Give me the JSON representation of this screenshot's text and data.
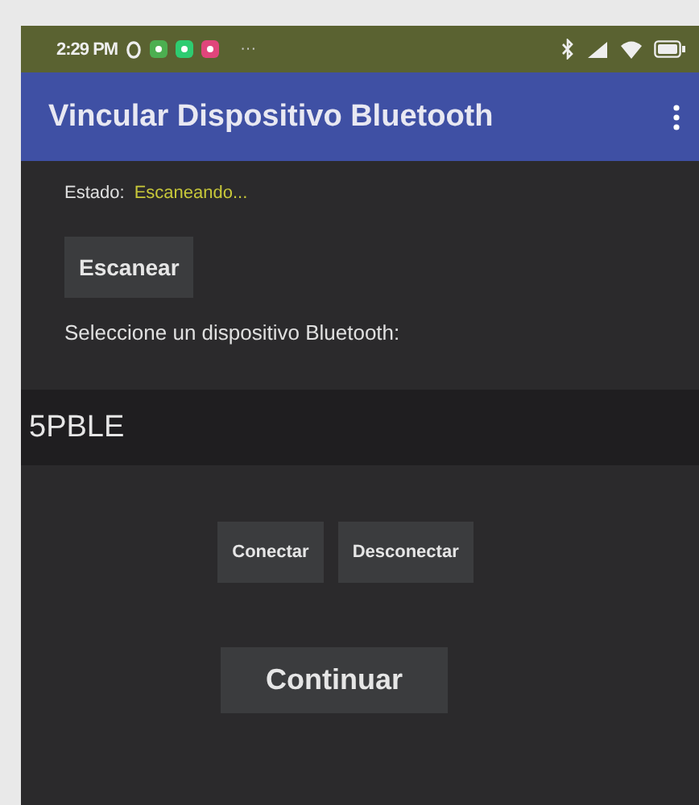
{
  "status_bar": {
    "time": "2:29 PM",
    "notification_icons": [
      {
        "color": "#4caf50"
      },
      {
        "color": "#2ecc71"
      },
      {
        "color": "#e0457b"
      }
    ],
    "more": "···"
  },
  "app_bar": {
    "title": "Vincular Dispositivo Bluetooth"
  },
  "status": {
    "label": "Estado:",
    "value": "Escaneando..."
  },
  "scan_button": "Escanear",
  "prompt": "Seleccione un dispositivo Bluetooth:",
  "devices": [
    {
      "name": "5PBLE",
      "selected": true
    }
  ],
  "action_buttons": [
    "Conectar",
    "Desconectar"
  ],
  "continue_button": "Continuar"
}
